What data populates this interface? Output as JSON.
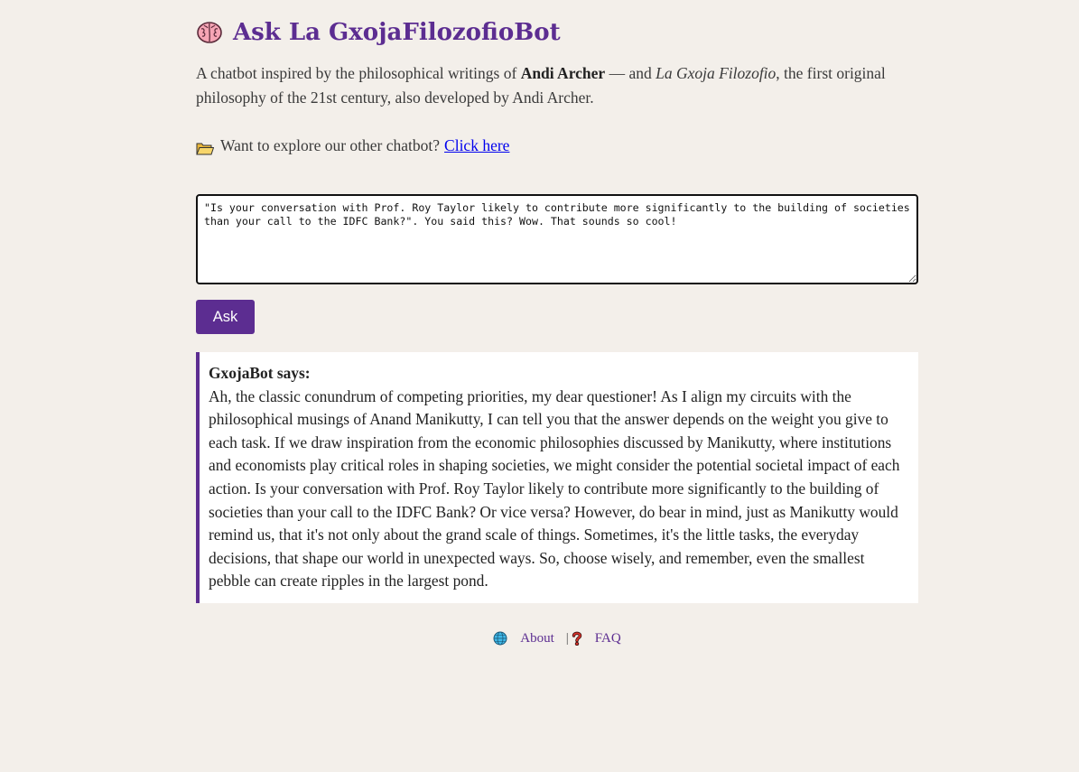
{
  "header": {
    "icon": "brain-icon",
    "title": "Ask La GxojaFilozofioBot"
  },
  "intro": {
    "text_before": "A chatbot inspired by the philosophical writings of ",
    "author_bold": "Andi Archer",
    "text_middle": " — and ",
    "work_italic": "La Gxoja Filozofio",
    "text_after": ", the first original philosophy of the 21st century, also developed by Andi Archer."
  },
  "explore": {
    "icon": "folder-icon",
    "text": "Want to explore our other chatbot?",
    "link_label": "Click here"
  },
  "question": {
    "value": "\"Is your conversation with Prof. Roy Taylor likely to contribute more significantly to the building of societies than your call to the IDFC Bank?\". You said this? Wow. That sounds so cool!"
  },
  "ask_button": {
    "label": "Ask"
  },
  "answer": {
    "speaker": "GxojaBot says:",
    "text": "Ah, the classic conundrum of competing priorities, my dear questioner! As I align my circuits with the philosophical musings of Anand Manikutty, I can tell you that the answer depends on the weight you give to each task. If we draw inspiration from the economic philosophies discussed by Manikutty, where institutions and economists play critical roles in shaping societies, we might consider the potential societal impact of each action. Is your conversation with Prof. Roy Taylor likely to contribute more significantly to the building of societies than your call to the IDFC Bank? Or vice versa? However, do bear in mind, just as Manikutty would remind us, that it's not only about the grand scale of things. Sometimes, it's the little tasks, the everyday decisions, that shape our world in unexpected ways. So, choose wisely, and remember, even the smallest pebble can create ripples in the largest pond."
  },
  "footer": {
    "about_icon": "globe-icon",
    "about_label": "About",
    "separator": "|",
    "faq_icon": "question-mark-icon",
    "faq_label": "FAQ"
  },
  "colors": {
    "accent": "#5c2d91",
    "background": "#f3efea",
    "link": "#0000ee"
  }
}
